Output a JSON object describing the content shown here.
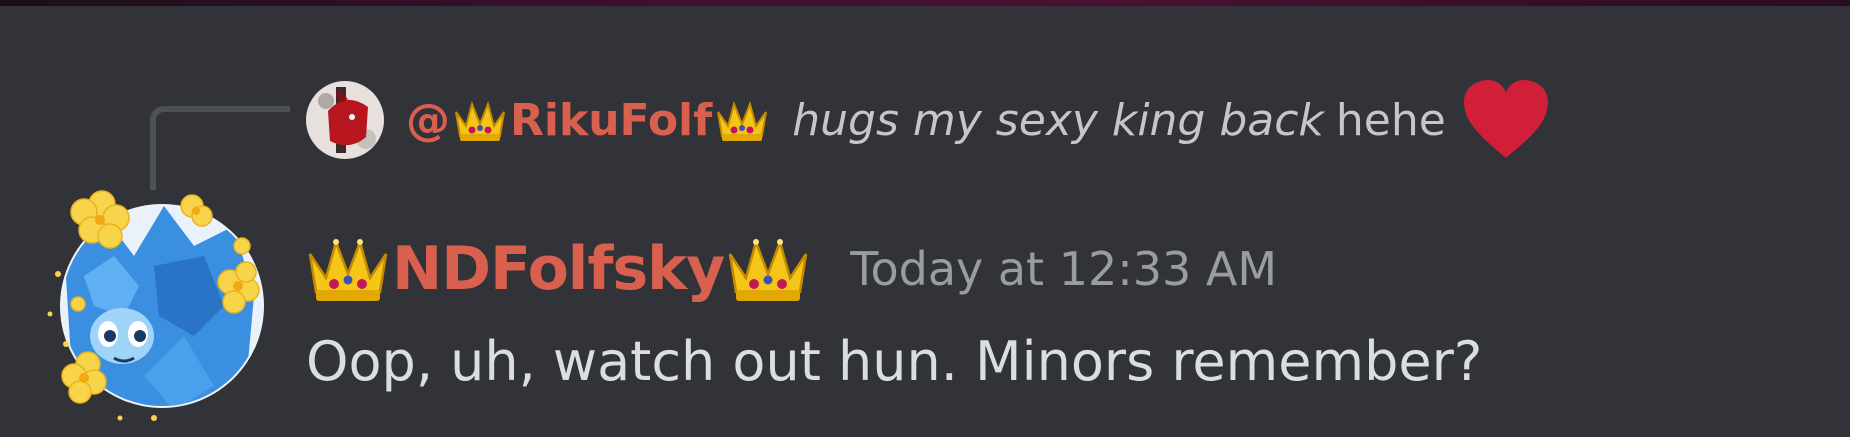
{
  "reply": {
    "at_symbol": "@",
    "username": "RikuFolf",
    "italic_text": "hugs my sexy king back",
    "plain_text": "hehe",
    "emoji": "heart-emoji"
  },
  "message": {
    "username": "NDFolfsky",
    "timestamp": "Today at 12:33 AM",
    "content": "Oop, uh, watch out hun. Minors remember?"
  },
  "colors": {
    "background": "#313338",
    "username": "#d9604e",
    "timestamp": "#9a9ca3",
    "text": "#dbdee1",
    "reply_spine": "#4e5058",
    "heart": "#d11f3a"
  },
  "icons": {
    "crown": "crown-emoji",
    "heart": "heart-emoji"
  }
}
